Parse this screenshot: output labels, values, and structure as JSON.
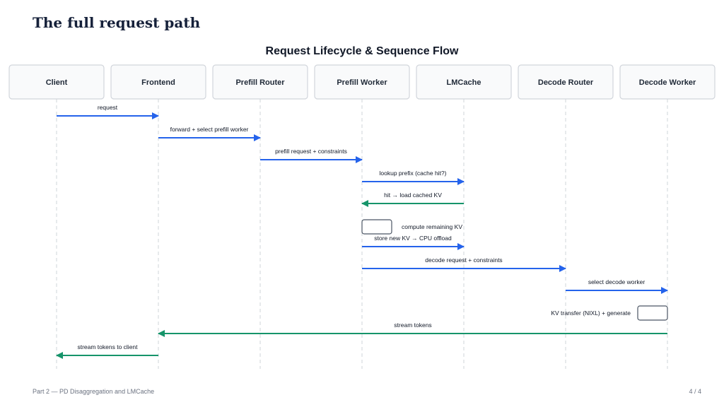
{
  "slide": {
    "title": "The full request path",
    "footer_left": "Part 2 — PD Disaggregation and LMCache",
    "footer_right": "4 / 4"
  },
  "diagram": {
    "title": "Request Lifecycle & Sequence Flow",
    "colors": {
      "request_arrow": "#2563eb",
      "response_arrow": "#16946a",
      "box_border": "#d1d5db",
      "box_fill": "#f9fafb",
      "lifeline": "#cfd4da"
    },
    "participants": [
      {
        "id": "client",
        "label": "Client"
      },
      {
        "id": "frontend",
        "label": "Frontend"
      },
      {
        "id": "prefill-router",
        "label": "Prefill Router"
      },
      {
        "id": "prefill-worker",
        "label": "Prefill Worker"
      },
      {
        "id": "lmcache",
        "label": "LMCache"
      },
      {
        "id": "decode-router",
        "label": "Decode Router"
      },
      {
        "id": "decode-worker",
        "label": "Decode Worker"
      }
    ],
    "messages": [
      {
        "type": "arrow",
        "from": "client",
        "to": "frontend",
        "label": "request",
        "color": "request"
      },
      {
        "type": "arrow",
        "from": "frontend",
        "to": "prefill-router",
        "label": "forward + select prefill worker",
        "color": "request"
      },
      {
        "type": "arrow",
        "from": "prefill-router",
        "to": "prefill-worker",
        "label": "prefill request + constraints",
        "color": "request"
      },
      {
        "type": "arrow",
        "from": "prefill-worker",
        "to": "lmcache",
        "label": "lookup prefix (cache hit?)",
        "color": "request"
      },
      {
        "type": "arrow",
        "from": "lmcache",
        "to": "prefill-worker",
        "label": "hit → load cached KV",
        "color": "response"
      },
      {
        "type": "self",
        "at": "prefill-worker",
        "side": "right",
        "label": "compute remaining KV"
      },
      {
        "type": "arrow",
        "from": "prefill-worker",
        "to": "lmcache",
        "label": "store new KV → CPU offload",
        "color": "request"
      },
      {
        "type": "arrow",
        "from": "prefill-worker",
        "to": "decode-router",
        "label": "decode request + constraints",
        "color": "request"
      },
      {
        "type": "arrow",
        "from": "decode-router",
        "to": "decode-worker",
        "label": "select decode worker",
        "color": "request"
      },
      {
        "type": "self",
        "at": "decode-worker",
        "side": "left",
        "label": "KV transfer (NIXL) + generate"
      },
      {
        "type": "arrow",
        "from": "decode-worker",
        "to": "frontend",
        "label": "stream tokens",
        "color": "response"
      },
      {
        "type": "arrow",
        "from": "frontend",
        "to": "client",
        "label": "stream tokens to client",
        "color": "response"
      }
    ]
  }
}
